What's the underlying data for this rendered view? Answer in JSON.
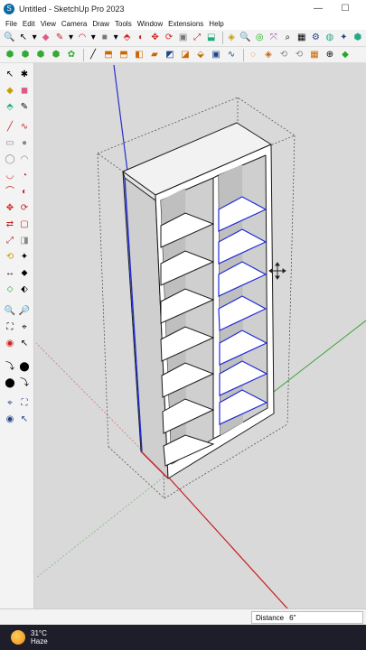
{
  "window": {
    "title": "Untitled - SketchUp Pro 2023",
    "app_icon": "sketchup-logo-icon",
    "minimize_glyph": "—",
    "maximize_glyph": "☐"
  },
  "menu": [
    "File",
    "Edit",
    "View",
    "Camera",
    "Draw",
    "Tools",
    "Window",
    "Extensions",
    "Help"
  ],
  "toolbar1": [
    "🔍",
    "↖",
    "▾",
    "◆",
    "✎",
    "▾",
    "◠",
    "▾",
    "■",
    "▾",
    "⬘",
    "◐",
    "✥",
    "⟳",
    "▣",
    "⤢",
    "⬓",
    "◈",
    "🔍",
    "◎",
    "⤧",
    "⌕",
    "▦",
    "⚙",
    "◍",
    "✦",
    "⬢"
  ],
  "toolbar2": [
    "⬢",
    "⬢",
    "⬢",
    "⬢",
    "✿",
    "╱",
    "⬒",
    "⬒",
    "◧",
    "▰",
    "◩",
    "◪",
    "⬙",
    "▣",
    "∿",
    "◌",
    "◈",
    "⟲",
    "⟲",
    "▦",
    "⊕",
    "◆"
  ],
  "left_tools": [
    "↖",
    "✱",
    "◆",
    "◼",
    "⬘",
    "✎",
    "╱",
    "∿",
    "▭",
    "●",
    "◯",
    "◠",
    "◡",
    "◔",
    "⌒",
    "◐",
    "✥",
    "⟳",
    "⇄",
    "▢",
    "⤢",
    "◨",
    "⟲",
    "✦",
    "↔",
    "⬥",
    "⬦",
    "⬖",
    "🔍",
    "🔎",
    "⛶",
    "⌖",
    "◉",
    "↖",
    "⤵",
    "⬤"
  ],
  "status": {
    "measure_label": "Distance",
    "measure_value": "6\""
  },
  "taskbar": {
    "temperature": "31°C",
    "condition": "Haze"
  },
  "colors": {
    "viewport_bg": "#d9d9d9",
    "shelf_face": "#ffffff",
    "shelf_edge": "#1a1a1a",
    "selected_edge": "#1f2bd6",
    "axis_red": "#c81e1e",
    "axis_green": "#2aa12a",
    "axis_blue": "#2430c8"
  }
}
